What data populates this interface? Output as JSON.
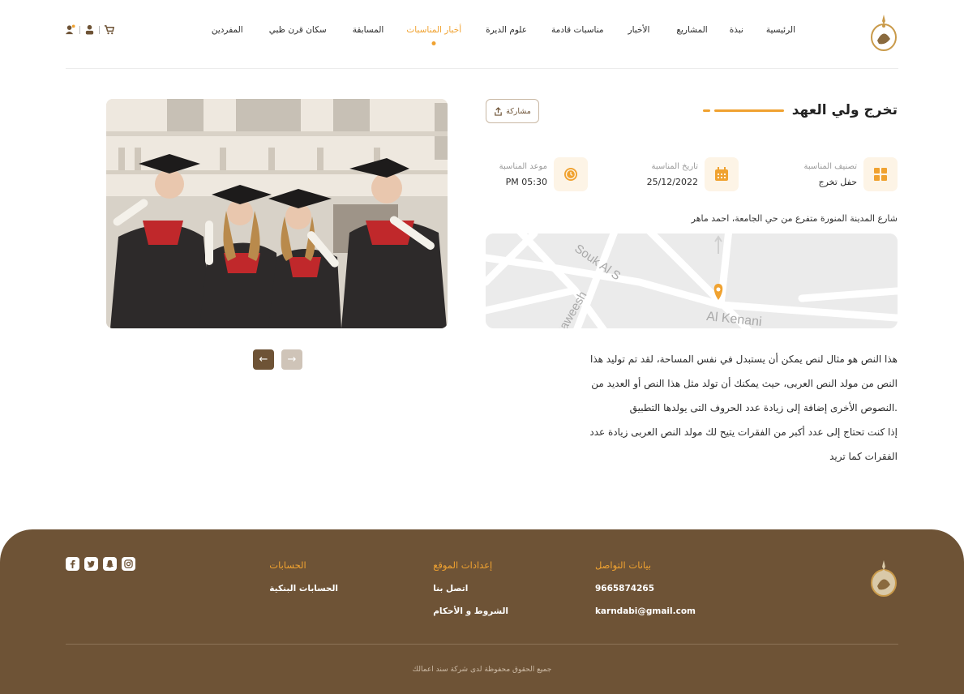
{
  "header": {
    "nav": [
      {
        "label": "الرئيسية",
        "active": false
      },
      {
        "label": "نبذة",
        "active": false
      },
      {
        "label": "المشاريع",
        "active": false
      },
      {
        "label": "الأخبار",
        "active": false
      },
      {
        "label": "مناسبات قادمة",
        "active": false
      },
      {
        "label": "علوم الديرة",
        "active": false
      },
      {
        "label": "أخبار المناسبات",
        "active": true
      },
      {
        "label": "المسابقة",
        "active": false
      },
      {
        "label": "سكان قرن ظبي",
        "active": false
      },
      {
        "label": "المفردين",
        "active": false
      }
    ],
    "icons": [
      "cart-icon",
      "user-icon",
      "user-notification-icon"
    ]
  },
  "event": {
    "title": "تخرج ولي العهد",
    "share_label": "مشاركة",
    "category_label": "تصنيف المناسبة",
    "category_value": "حفل تخرج",
    "date_label": "تاريخ المناسبة",
    "date_value": "25/12/2022",
    "time_label": "موعد المناسبة",
    "time_value": "05:30 PM",
    "address": "شارع المدينة المنورة متفرع من حي الجامعة، احمد ماهر",
    "map_labels": {
      "street1": "Gaweesh",
      "street2": "Souk Al S",
      "street3": "Al Kenani"
    },
    "description": [
      "هذا النص هو مثال لنص يمكن أن يستبدل في نفس المساحة، لقد تم توليد هذا",
      "النص من مولد النص العربى، حيث يمكنك أن تولد مثل هذا النص أو العديد من",
      ".النصوص الأخرى إضافة إلى زيادة عدد الحروف التى يولدها التطبيق",
      "إذا كنت تحتاج إلى عدد أكبر من الفقرات يتيح لك مولد النص العربى زيادة عدد",
      "الفقرات كما تريد"
    ],
    "prev_arrow": "←",
    "next_arrow": "→"
  },
  "footer": {
    "contact_title": "بيانات التواصل",
    "phone": "9665874265",
    "email": "karndabi@gmail.com",
    "settings_title": "إعدادات الموقع",
    "contact_us": "اتصل بنا",
    "terms": "الشروط و الأحكام",
    "accounts_title": "الحسابات",
    "bank_accounts": "الحسابات البنكية",
    "socials": [
      "instagram-icon",
      "snapchat-icon",
      "twitter-icon",
      "facebook-icon"
    ],
    "copyright": "جميع الحقوق محفوظة لدى شركة سند اعمالك"
  },
  "colors": {
    "accent": "#f0a230",
    "brown": "#6e5336"
  }
}
